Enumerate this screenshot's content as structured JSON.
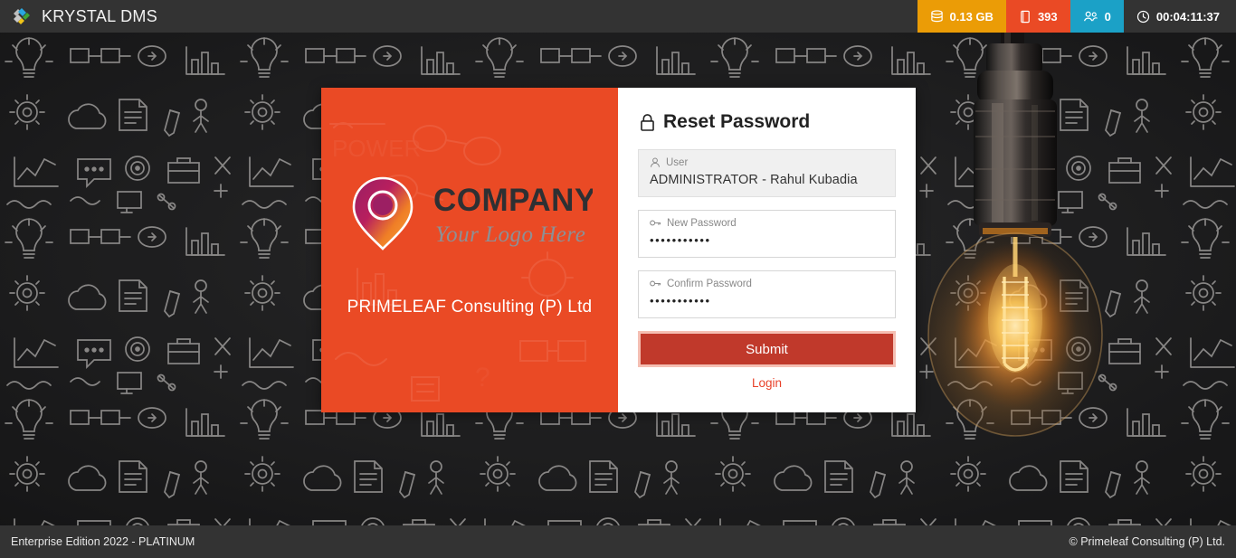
{
  "header": {
    "brand_title": "KRYSTAL DMS",
    "logo_icon": "krystal-diamond-logo",
    "badges": [
      {
        "id": "storage",
        "icon": "database-icon",
        "label": "0.13 GB",
        "color": "#eb9c06"
      },
      {
        "id": "documents",
        "icon": "file-icon",
        "label": "393",
        "color": "#ea4a25"
      },
      {
        "id": "users",
        "icon": "users-icon",
        "label": "0",
        "color": "#1ba1c7"
      },
      {
        "id": "session-timer",
        "icon": "clock-icon",
        "label": "00:04:11:37",
        "color": "#333333"
      }
    ]
  },
  "branding": {
    "logo_alt": "COMPANY",
    "logo_word": "COMPANY",
    "logo_tagline": "Your Logo Here",
    "company_name": "PRIMELEAF Consulting (P) Ltd",
    "panel_color": "#ea4a25"
  },
  "form": {
    "title": "Reset Password",
    "title_icon": "lock-icon",
    "fields": [
      {
        "name": "user",
        "icon": "person-icon",
        "label": "User",
        "value": "ADMINISTRATOR - Rahul Kubadia",
        "placeholder": "User",
        "readonly": true,
        "masked": false
      },
      {
        "name": "new-password",
        "icon": "key-icon",
        "label": "New Password",
        "value": "•••••••••••",
        "placeholder": "New Password",
        "readonly": false,
        "masked": true
      },
      {
        "name": "confirm-password",
        "icon": "key-icon",
        "label": "Confirm Password",
        "value": "•••••••••••",
        "placeholder": "Confirm Password",
        "readonly": false,
        "masked": true
      }
    ],
    "submit_label": "Submit",
    "submit_color": "#c0392b",
    "login_link_label": "Login",
    "login_link_color": "#e8412a"
  },
  "footer": {
    "edition": "Enterprise Edition 2022 - PLATINUM",
    "copyright": "© Primeleaf Consulting (P) Ltd."
  }
}
